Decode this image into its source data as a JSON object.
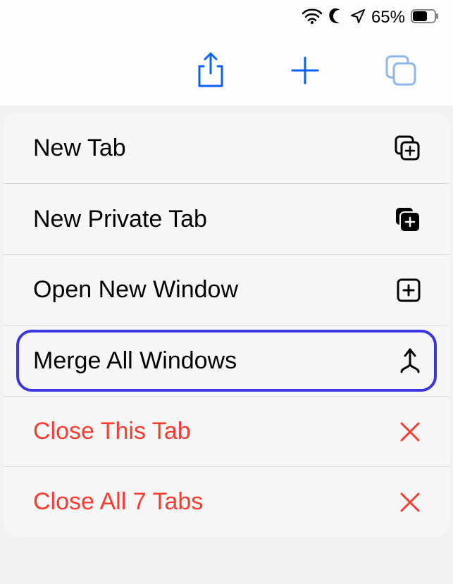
{
  "status": {
    "battery_percent": "65%"
  },
  "menu": {
    "items": [
      {
        "label": "New Tab",
        "icon": "plus-on-square-icon",
        "destructive": false,
        "highlighted": false
      },
      {
        "label": "New Private Tab",
        "icon": "plus-on-square-fill-icon",
        "destructive": false,
        "highlighted": false
      },
      {
        "label": "Open New Window",
        "icon": "plus-square-icon",
        "destructive": false,
        "highlighted": false
      },
      {
        "label": "Merge All Windows",
        "icon": "merge-icon",
        "destructive": false,
        "highlighted": true
      },
      {
        "label": "Close This Tab",
        "icon": "close-x-icon",
        "destructive": true,
        "highlighted": false
      },
      {
        "label": "Close All 7 Tabs",
        "icon": "close-x-icon",
        "destructive": true,
        "highlighted": false
      }
    ]
  }
}
